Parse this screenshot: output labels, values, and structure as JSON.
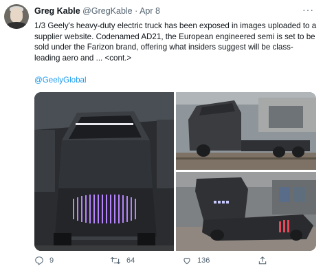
{
  "tweet": {
    "author_name": "Greg Kable",
    "handle": "@GregKable",
    "separator": "·",
    "date": "Apr 8",
    "more_label": "···",
    "text": "1/3 Geely's heavy-duty electric truck has been exposed in images uploaded to a supplier website. Codenamed AD21, the European engineered semi is set to be sold under the Farizon brand, offering what insiders suggest will be class-leading aero and ... <cont.>",
    "mention": "@GeelyGlobal"
  },
  "actions": {
    "replies": "9",
    "retweets": "64",
    "likes": "136"
  },
  "icons": {
    "reply": "reply-icon",
    "retweet": "retweet-icon",
    "like": "heart-icon",
    "share": "share-icon",
    "more": "more-icon"
  },
  "colors": {
    "link": "#1d9bf0",
    "secondary_text": "#536471",
    "truck_light_bar": "#b784ff"
  }
}
